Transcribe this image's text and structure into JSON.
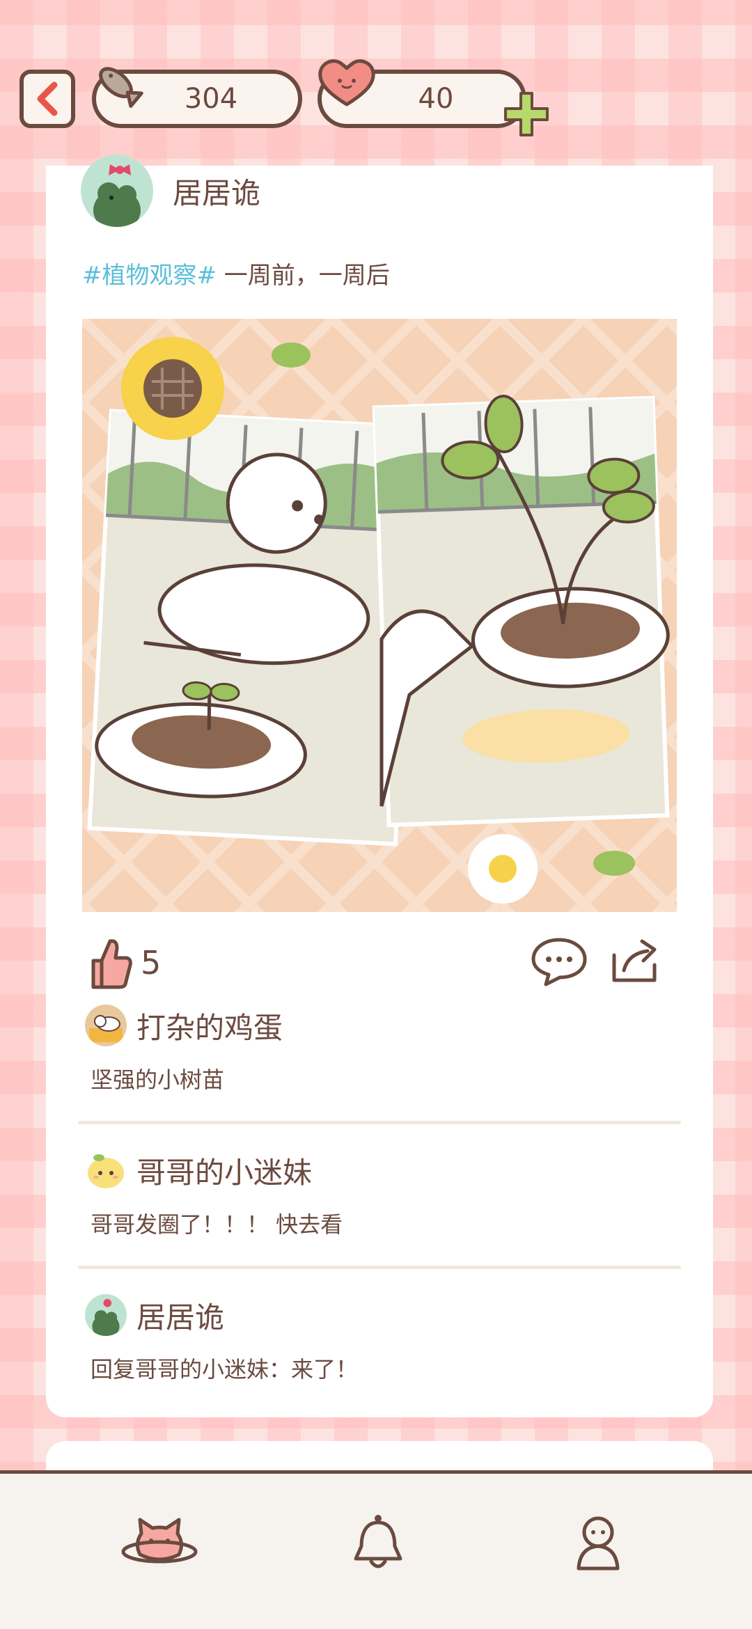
{
  "topbar": {
    "fish_count": "304",
    "heart_count": "40"
  },
  "post": {
    "author": "居居诡",
    "hashtag": "#植物观察#",
    "text": " 一周前，一周后",
    "likes": "5"
  },
  "comments": [
    {
      "name": "打杂的鸡蛋",
      "text": "坚强的小树苗"
    },
    {
      "name": "哥哥的小迷妹",
      "text": "哥哥发圈了！！！ 快去看"
    },
    {
      "name": "居居诡",
      "text": "回复哥哥的小迷妹：来了！"
    }
  ],
  "icons": {
    "back": "chevron-left-icon",
    "fish": "fish-icon",
    "heart": "heart-icon",
    "plus": "plus-icon",
    "like": "thumbs-up-icon",
    "comment": "speech-bubble-icon",
    "share": "share-icon",
    "nav_home": "cat-planet-icon",
    "nav_bell": "bell-icon",
    "nav_profile": "profile-icon"
  },
  "colors": {
    "accent_brown": "#6b4a3f",
    "hashtag_blue": "#5bbfd8",
    "back_red": "#e8564a",
    "plus_green": "#b8d86a"
  }
}
